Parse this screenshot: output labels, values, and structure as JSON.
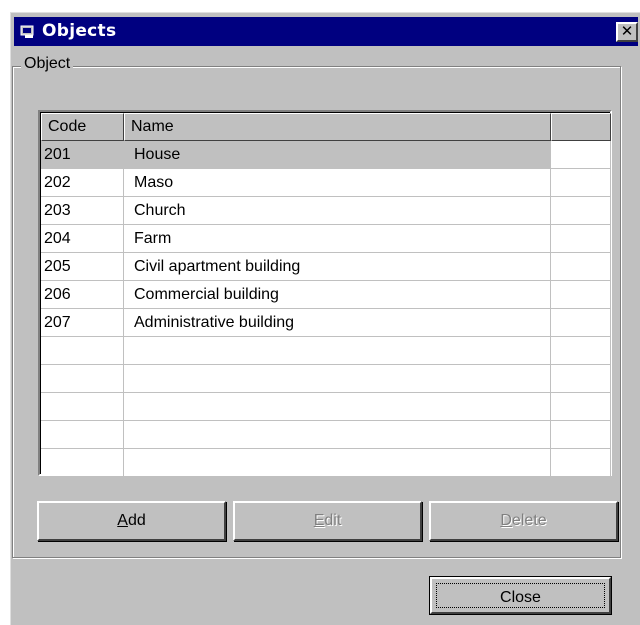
{
  "window": {
    "title": "Objects"
  },
  "group": {
    "label": "Object"
  },
  "grid": {
    "columns": [
      "Code",
      "Name",
      ""
    ],
    "rows": [
      {
        "code": "201",
        "name": "House",
        "selected": true
      },
      {
        "code": "202",
        "name": "Maso"
      },
      {
        "code": "203",
        "name": "Church"
      },
      {
        "code": "204",
        "name": "Farm"
      },
      {
        "code": "205",
        "name": "Civil apartment building"
      },
      {
        "code": "206",
        "name": "Commercial building"
      },
      {
        "code": "207",
        "name": "Administrative building"
      },
      {
        "code": "",
        "name": ""
      },
      {
        "code": "",
        "name": ""
      },
      {
        "code": "",
        "name": ""
      },
      {
        "code": "",
        "name": ""
      },
      {
        "code": "",
        "name": ""
      }
    ]
  },
  "buttons": {
    "add": {
      "accel": "A",
      "rest": "dd"
    },
    "edit": {
      "accel": "E",
      "rest": "dit",
      "enabled": false
    },
    "delete": {
      "accel": "D",
      "rest": "elete",
      "enabled": false
    },
    "close": "Close"
  },
  "icons": {
    "title": "window-app-icon",
    "close": "close-icon"
  },
  "colors": {
    "titlebar": "#000080",
    "face": "#c0c0c0",
    "selected_row": "#c0c0c0"
  }
}
